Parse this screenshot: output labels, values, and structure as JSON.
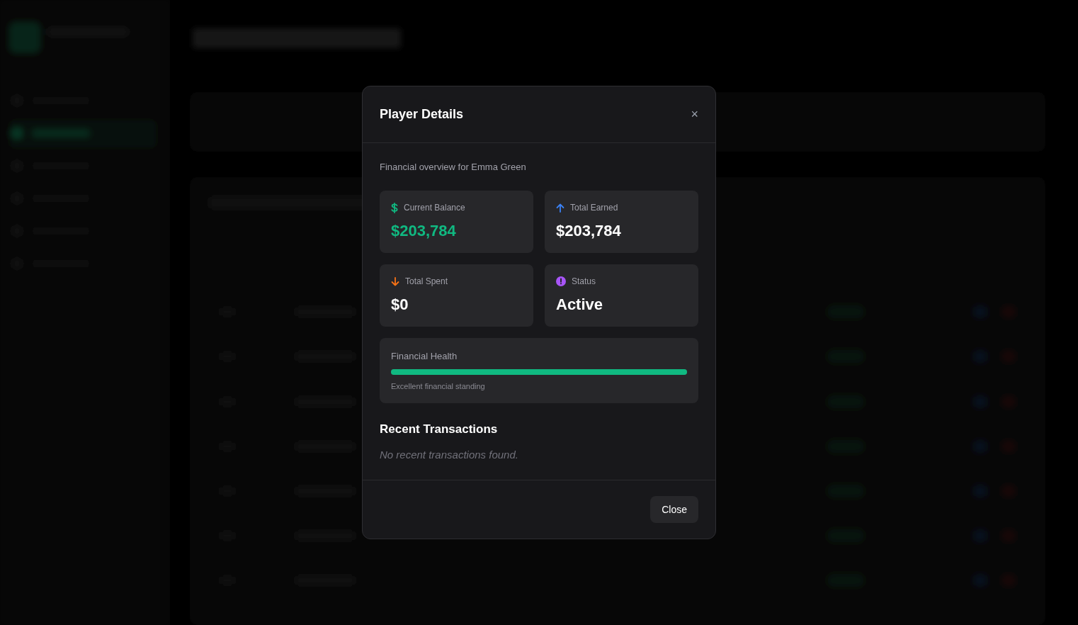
{
  "dialog": {
    "title": "Player Details",
    "close_icon": "×",
    "subtitle": "Financial overview for Emma Green",
    "stats": [
      {
        "kind": "balance",
        "label": "Current Balance",
        "value": "$203,784"
      },
      {
        "kind": "earned",
        "label": "Total Earned",
        "value": "$203,784"
      },
      {
        "kind": "spent",
        "label": "Total Spent",
        "value": "$0"
      },
      {
        "kind": "status",
        "label": "Status",
        "value": "Active"
      }
    ],
    "health": {
      "label": "Financial Health",
      "level": 1,
      "note": "Excellent financial standing"
    },
    "transactions": {
      "title": "Recent Transactions",
      "empty": "No recent transactions found."
    },
    "close_button": "Close"
  }
}
